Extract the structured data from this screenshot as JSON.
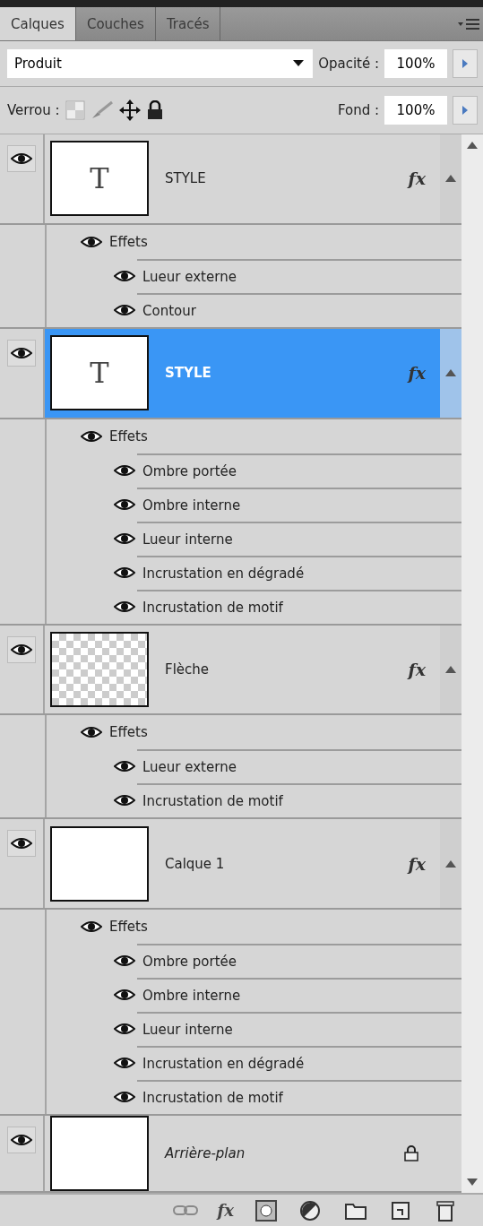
{
  "tabs": [
    {
      "label": "Calques",
      "selected": true
    },
    {
      "label": "Couches",
      "selected": false
    },
    {
      "label": "Tracés",
      "selected": false
    }
  ],
  "blend_mode": {
    "value": "Produit"
  },
  "opacity": {
    "label": "Opacité :",
    "value": "100%"
  },
  "lock": {
    "label": "Verrou :"
  },
  "fill": {
    "label": "Fond :",
    "value": "100%"
  },
  "layers": [
    {
      "name": "STYLE",
      "kind": "normal",
      "thumbnail": {
        "kind": "text",
        "glyph": "T"
      },
      "selected": false,
      "visible": true,
      "fx": "fx",
      "expanded": true,
      "effects_label": "Effets",
      "effects": [
        {
          "name": "Lueur externe"
        },
        {
          "name": "Contour"
        }
      ]
    },
    {
      "name": "STYLE",
      "kind": "normal",
      "thumbnail": {
        "kind": "text",
        "glyph": "T"
      },
      "selected": true,
      "visible": true,
      "fx": "fx",
      "expanded": true,
      "effects_label": "Effets",
      "effects": [
        {
          "name": "Ombre portée"
        },
        {
          "name": "Ombre interne"
        },
        {
          "name": "Lueur interne"
        },
        {
          "name": "Incrustation en dégradé"
        },
        {
          "name": "Incrustation de motif"
        }
      ]
    },
    {
      "name": "Flèche",
      "kind": "normal",
      "thumbnail": {
        "kind": "transparent"
      },
      "selected": false,
      "visible": true,
      "fx": "fx",
      "expanded": true,
      "effects_label": "Effets",
      "effects": [
        {
          "name": "Lueur externe"
        },
        {
          "name": "Incrustation de motif"
        }
      ]
    },
    {
      "name": "Calque 1",
      "kind": "normal",
      "thumbnail": {
        "kind": "blank"
      },
      "selected": false,
      "visible": true,
      "fx": "fx",
      "expanded": true,
      "effects_label": "Effets",
      "effects": [
        {
          "name": "Ombre portée"
        },
        {
          "name": "Ombre interne"
        },
        {
          "name": "Lueur interne"
        },
        {
          "name": "Incrustation en dégradé"
        },
        {
          "name": "Incrustation de motif"
        }
      ]
    },
    {
      "name": "Arrière-plan",
      "kind": "background",
      "thumbnail": {
        "kind": "blank"
      },
      "selected": false,
      "visible": true
    }
  ],
  "toolbar": [
    {
      "kind": "link"
    },
    {
      "kind": "fx",
      "label": "fx"
    },
    {
      "kind": "mask"
    },
    {
      "kind": "adjustment"
    },
    {
      "kind": "group"
    },
    {
      "kind": "new"
    },
    {
      "kind": "delete"
    }
  ]
}
